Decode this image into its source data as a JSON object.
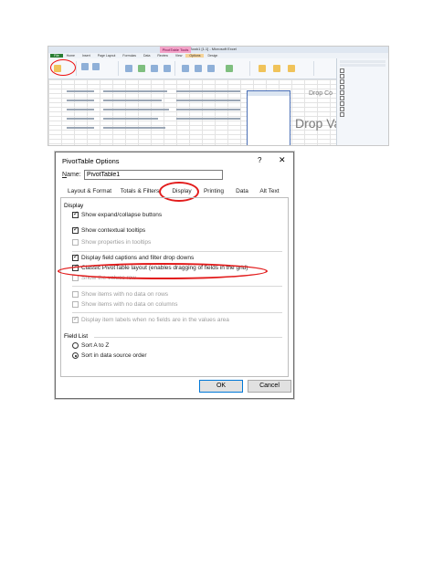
{
  "excel": {
    "window_title": "Book1 [1.1] - Microsoft Excel",
    "pivot_tools_label": "PivotTable Tools",
    "tabs": [
      "File",
      "Home",
      "Insert",
      "Page Layout",
      "Formulas",
      "Data",
      "Review",
      "View",
      "Options",
      "Design"
    ],
    "drop_small": "Drop Co",
    "drop_large": "Drop Valu"
  },
  "dialog": {
    "title": "PivotTable Options",
    "help": "?",
    "close": "✕",
    "name_label_first": "N",
    "name_label_rest": "ame:",
    "name_value": "PivotTable1",
    "tabs": [
      {
        "label": "Layout & Format"
      },
      {
        "label": "Totals & Filters"
      },
      {
        "label": "Display"
      },
      {
        "label": "Printing"
      },
      {
        "label": "Data"
      },
      {
        "label": "Alt Text"
      }
    ],
    "display_section": "Display",
    "options": [
      {
        "label": "Show expand/collapse buttons",
        "checked": true,
        "disabled": false
      },
      {
        "label": "Show contextual tooltips",
        "checked": true,
        "disabled": false
      },
      {
        "label": "Show properties in tooltips",
        "checked": false,
        "disabled": true
      },
      {
        "label": "Display field captions and filter drop downs",
        "checked": true,
        "disabled": false
      },
      {
        "label": "Classic PivotTable layout (enables dragging of fields in the grid)",
        "checked": true,
        "disabled": false
      },
      {
        "label": "Show the values row",
        "checked": false,
        "disabled": true
      },
      {
        "label": "Show items with no data on rows",
        "checked": false,
        "disabled": true
      },
      {
        "label": "Show items with no data on columns",
        "checked": false,
        "disabled": true
      },
      {
        "label": "Display item labels when no fields are in the values area",
        "checked": true,
        "disabled": true
      }
    ],
    "field_list_section": "Field List",
    "sort_options": [
      {
        "label": "Sort A to Z",
        "selected": false
      },
      {
        "label": "Sort in data source order",
        "selected": true
      }
    ],
    "ok_label": "OK",
    "cancel_label": "Cancel"
  },
  "colors": {
    "highlight_circle": "#e21b1b",
    "ok_border": "#0078d7"
  }
}
